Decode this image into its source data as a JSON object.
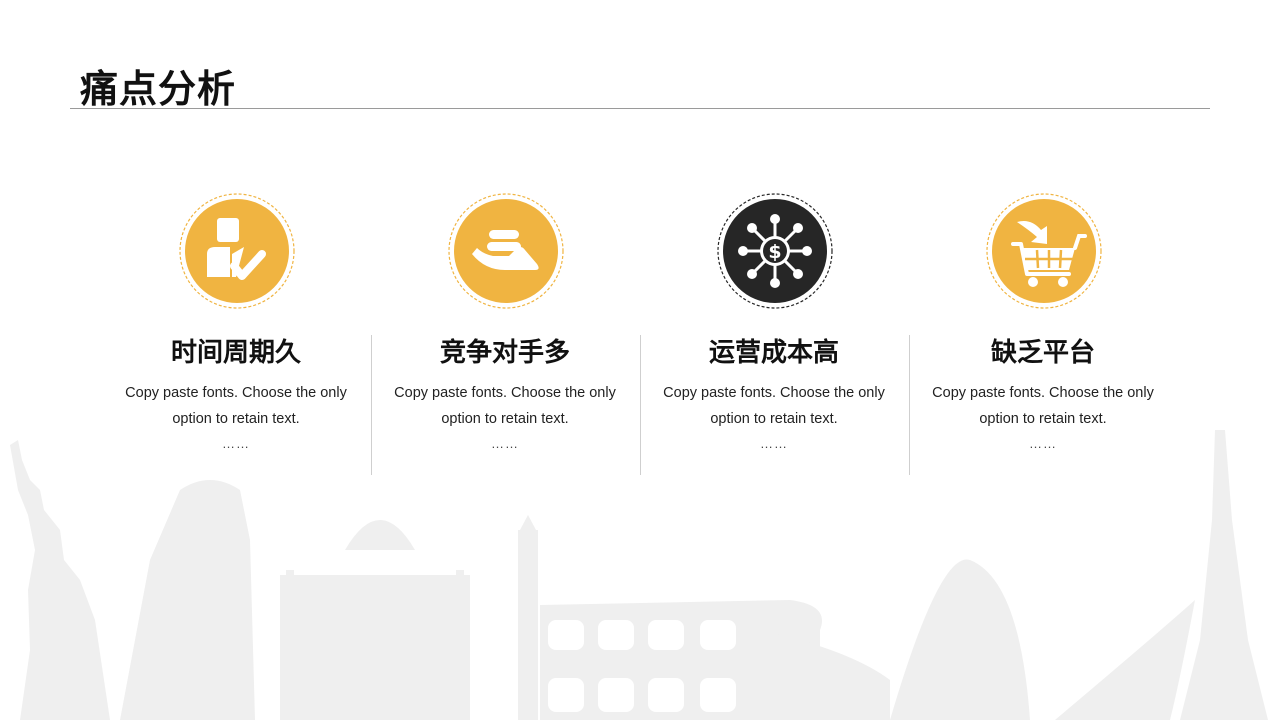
{
  "slide": {
    "title": "痛点分析"
  },
  "colors": {
    "accent": "#F0B441",
    "dark": "#262626",
    "skyline": "#EFEFEF"
  },
  "cards": [
    {
      "name": "时间周期久",
      "desc_line1": "Copy paste fonts. Choose the only",
      "desc_line2": "option to retain text.",
      "more": "……",
      "icon": "businessman-check-icon"
    },
    {
      "name": "竞争对手多",
      "desc_line1": "Copy paste fonts. Choose the only",
      "desc_line2": "option to retain text.",
      "more": "……",
      "icon": "hand-coins-icon"
    },
    {
      "name": "运营成本高",
      "desc_line1": "Copy paste fonts. Choose the only",
      "desc_line2": "option to retain text.",
      "more": "……",
      "icon": "dollar-network-icon"
    },
    {
      "name": "缺乏平台",
      "desc_line1": "Copy paste fonts. Choose the only",
      "desc_line2": "option to retain text.",
      "more": "……",
      "icon": "shopping-cart-icon"
    }
  ]
}
